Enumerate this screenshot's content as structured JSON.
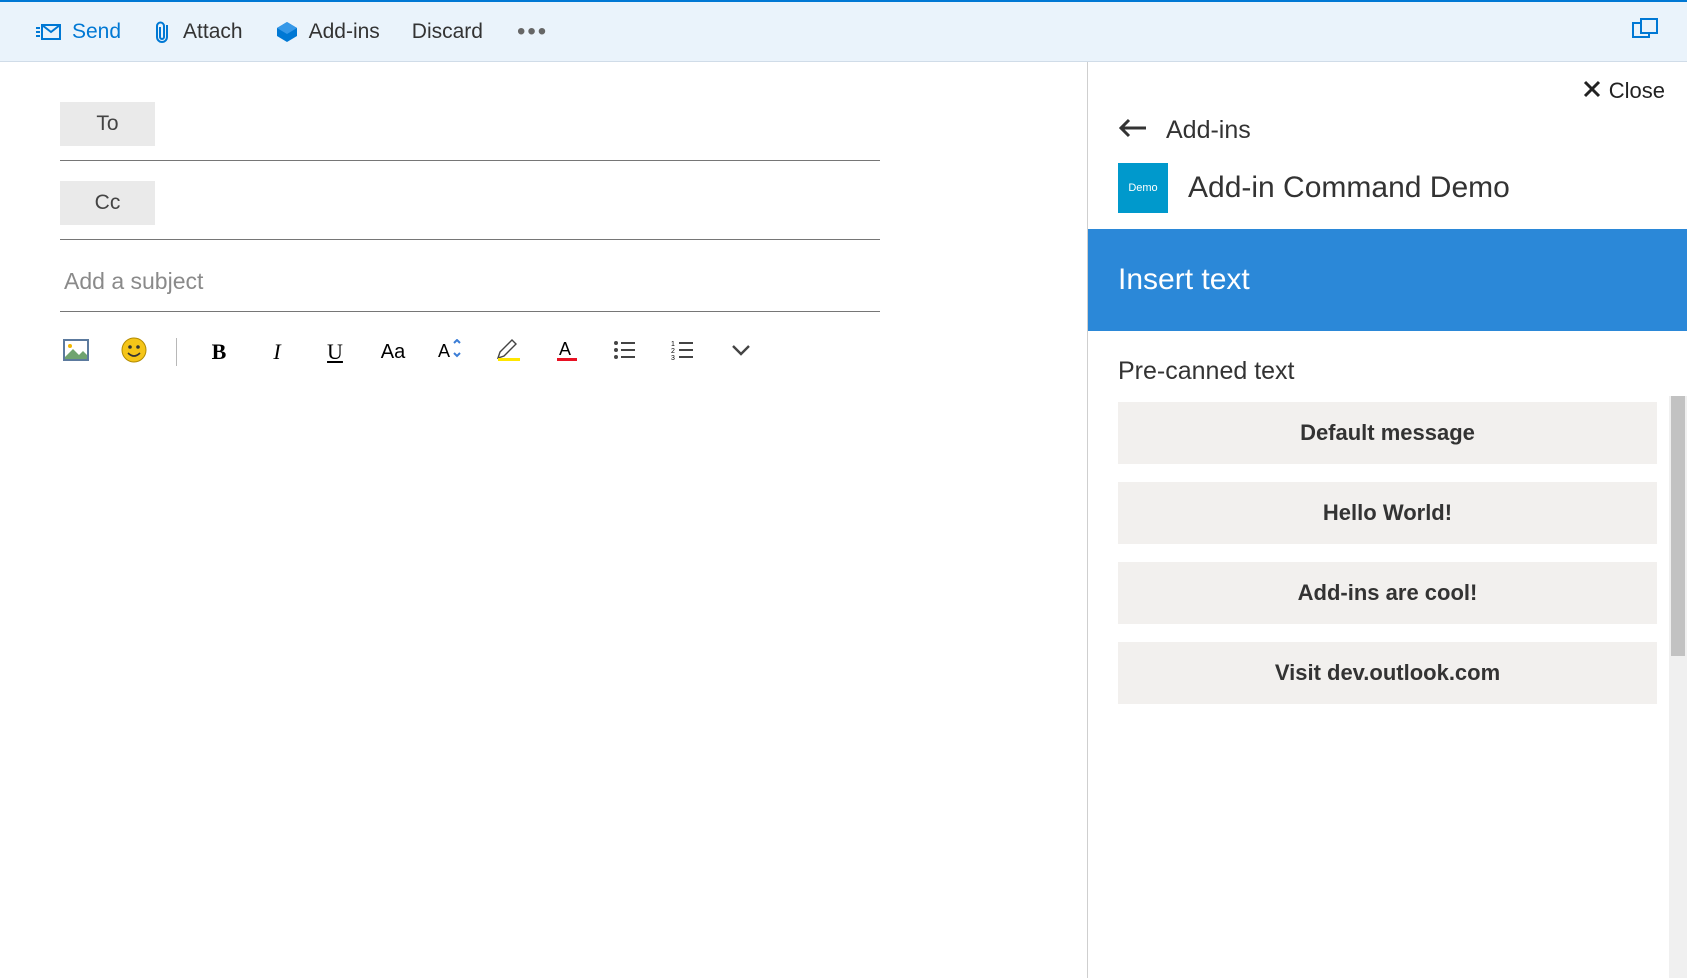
{
  "toolbar": {
    "send": "Send",
    "attach": "Attach",
    "addins": "Add-ins",
    "discard": "Discard"
  },
  "compose": {
    "to_label": "To",
    "cc_label": "Cc",
    "subject_placeholder": "Add a subject"
  },
  "pane": {
    "close": "Close",
    "back_label": "Add-ins",
    "badge": "Demo",
    "title": "Add-in Command Demo",
    "banner": "Insert text",
    "section": "Pre-canned text",
    "items": [
      "Default message",
      "Hello World!",
      "Add-ins are cool!",
      "Visit dev.outlook.com"
    ]
  }
}
